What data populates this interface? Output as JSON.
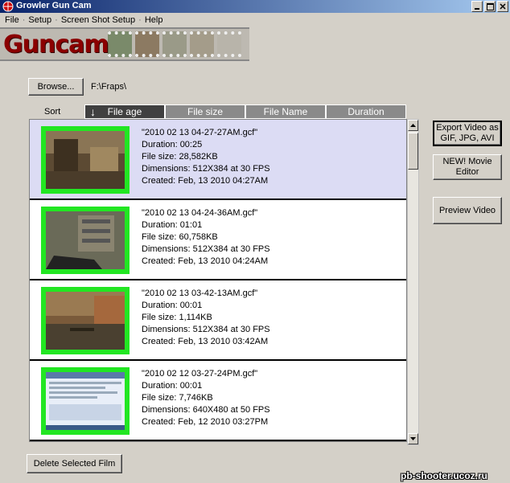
{
  "window": {
    "title": "Growler Gun Cam"
  },
  "menu": [
    "File",
    "Setup",
    "Screen Shot Setup",
    "Help"
  ],
  "banner": {
    "logo_text": "Guncam"
  },
  "browse": {
    "label": "Browse...",
    "path": "F:\\Fraps\\"
  },
  "sort": {
    "label": "Sort",
    "active": "File age",
    "tabs": [
      "File age",
      "File size",
      "File Name",
      "Duration"
    ]
  },
  "files": [
    {
      "name": "\"2010 02 13 04-27-27AM.gcf\"",
      "duration": "Duration: 00:25",
      "size": "File size: 28,582KB",
      "dimensions": "Dimensions: 512X384 at 30 FPS",
      "created": "Created: Feb, 13 2010 04:27AM",
      "selected": true
    },
    {
      "name": "\"2010 02 13 04-24-36AM.gcf\"",
      "duration": "Duration: 01:01",
      "size": "File size: 60,758KB",
      "dimensions": "Dimensions: 512X384 at 30 FPS",
      "created": "Created: Feb, 13 2010 04:24AM",
      "selected": false
    },
    {
      "name": "\"2010 02 13 03-42-13AM.gcf\"",
      "duration": "Duration: 00:01",
      "size": "File size: 1,114KB",
      "dimensions": "Dimensions: 512X384 at 30 FPS",
      "created": "Created: Feb, 13 2010 03:42AM",
      "selected": false
    },
    {
      "name": "\"2010 02 12 03-27-24PM.gcf\"",
      "duration": "Duration: 00:01",
      "size": "File size: 7,746KB",
      "dimensions": "Dimensions: 640X480 at 50 FPS",
      "created": "Created: Feb, 12 2010 03:27PM",
      "selected": false
    }
  ],
  "buttons": {
    "export": "Export Video as GIF, JPG, AVI",
    "editor": "NEW! Movie Editor",
    "preview": "Preview Video",
    "delete": "Delete Selected Film"
  },
  "watermark": "pb-shooter.ucoz.ru",
  "colors": {
    "title_bar": "#0a246a",
    "thumb_border": "#22e622",
    "selected_row": "#dcdcf4"
  }
}
